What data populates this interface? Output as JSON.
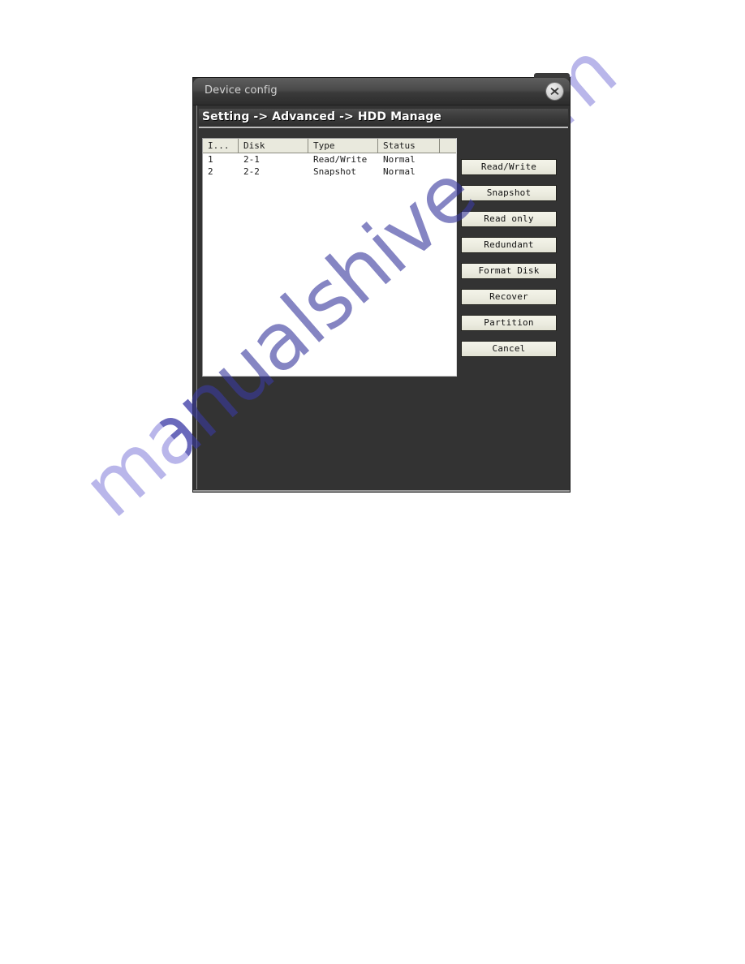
{
  "window": {
    "title": "Device config",
    "close_icon": "close-icon"
  },
  "banner": {
    "breadcrumb": "Setting -> Advanced -> HDD Manage"
  },
  "hdd_table": {
    "columns": [
      "I...",
      "Disk",
      "Type",
      "Status",
      ""
    ],
    "rows": [
      {
        "id": "1",
        "disk": "2-1",
        "type": "Read/Write",
        "status": "Normal",
        "extra": ""
      },
      {
        "id": "2",
        "disk": "2-2",
        "type": "Snapshot",
        "status": "Normal",
        "extra": ""
      }
    ]
  },
  "actions": [
    {
      "label": "Read/Write"
    },
    {
      "label": "Snapshot"
    },
    {
      "label": "Read only"
    },
    {
      "label": "Redundant"
    },
    {
      "label": "Format Disk"
    },
    {
      "label": "Recover"
    },
    {
      "label": "Partition"
    },
    {
      "label": "Cancel"
    }
  ],
  "watermark": {
    "text": "manualshive.com"
  },
  "colors": {
    "dialog_background": "#333333",
    "titlebar": "#4a4a4a",
    "banner_text": "#ffffff",
    "list_background": "#ffffff",
    "header_row": "#e9e9dd",
    "button_face": "#ececE0",
    "watermark": "#b9b6ea"
  }
}
